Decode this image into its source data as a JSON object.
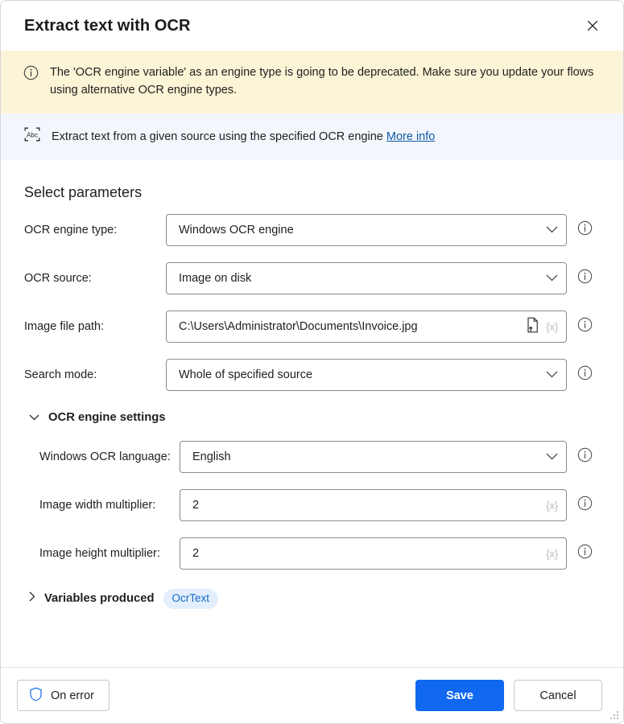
{
  "window": {
    "title": "Extract text with OCR",
    "close_icon": "close-icon"
  },
  "warning_banner": {
    "icon": "info-circle-icon",
    "text": "The 'OCR engine variable' as an engine type is going to be deprecated.  Make sure you update your flows using alternative OCR engine types.",
    "background_color": "#fcf4d6"
  },
  "info_banner": {
    "icon": "ocr-abc-icon",
    "text": "Extract text from a given source using the specified OCR engine",
    "link_label": "More info",
    "link_color": "#1057a8",
    "background_color": "#f3f7fd"
  },
  "form": {
    "section_title": "Select parameters",
    "fields": [
      {
        "label": "OCR engine type:",
        "value": "Windows OCR engine",
        "control": "dropdown",
        "name": "ocr-engine-type"
      },
      {
        "label": "OCR source:",
        "value": "Image on disk",
        "control": "dropdown",
        "name": "ocr-source"
      },
      {
        "label": "Image file path:",
        "value": "C:\\Users\\Administrator\\Documents\\Invoice.jpg",
        "control": "textfield",
        "name": "image-file-path",
        "variable_icon": "{x}",
        "file_picker_icon": "file-upload-icon"
      },
      {
        "label": "Search mode:",
        "value": "Whole of specified source",
        "control": "dropdown",
        "name": "search-mode"
      }
    ]
  },
  "engine_settings": {
    "group_label": "OCR engine settings",
    "expanded": true,
    "chevron": "chevron-down-icon",
    "fields": [
      {
        "label": "Windows OCR language:",
        "value": "English",
        "control": "dropdown",
        "name": "windows-ocr-language"
      },
      {
        "label": "Image width multiplier:",
        "value": "2",
        "control": "textfield",
        "name": "image-width-multiplier",
        "variable_icon": "{x}"
      },
      {
        "label": "Image height multiplier:",
        "value": "2",
        "control": "textfield",
        "name": "image-height-multiplier",
        "variable_icon": "{x}"
      }
    ]
  },
  "variables_produced": {
    "group_label": "Variables produced",
    "expanded": false,
    "chevron": "chevron-right-icon",
    "badge": "OcrText",
    "badge_bg": "#e3effc",
    "badge_color": "#1567c8"
  },
  "footer": {
    "on_error_label": "On error",
    "on_error_icon": "shield-icon",
    "save_label": "Save",
    "cancel_label": "Cancel",
    "save_color": "#1068f0"
  }
}
